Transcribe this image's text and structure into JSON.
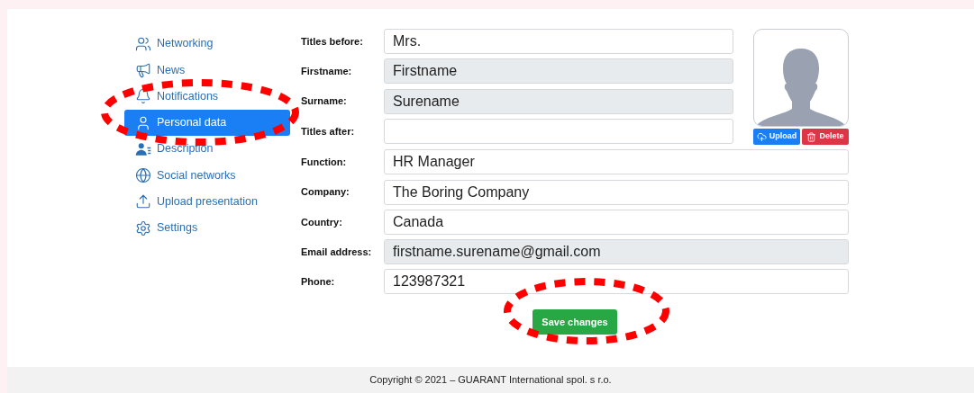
{
  "sidebar": {
    "items": [
      {
        "label": "Networking",
        "selected": false
      },
      {
        "label": "News",
        "selected": false
      },
      {
        "label": "Notifications",
        "selected": false
      },
      {
        "label": "Personal data",
        "selected": true
      },
      {
        "label": "Description",
        "selected": false
      },
      {
        "label": "Social networks",
        "selected": false
      },
      {
        "label": "Upload presentation",
        "selected": false
      },
      {
        "label": "Settings",
        "selected": false
      }
    ]
  },
  "form": {
    "fields": [
      {
        "label": "Titles before:",
        "value": "Mrs.",
        "disabled": false
      },
      {
        "label": "Firstname:",
        "value": "Firstname",
        "disabled": true
      },
      {
        "label": "Surname:",
        "value": "Surename",
        "disabled": true
      },
      {
        "label": "Titles after:",
        "disabled": false
      },
      {
        "label": "Function:",
        "value": "HR Manager",
        "disabled": false
      },
      {
        "label": "Company:",
        "value": "The Boring Company",
        "disabled": false
      },
      {
        "label": "Country:",
        "value": "Canada",
        "disabled": false
      },
      {
        "label": "Email address:",
        "value": "firstname.surename@gmail.com",
        "disabled": true
      },
      {
        "label": "Phone:",
        "value": "123987321",
        "disabled": false
      }
    ],
    "photo": {
      "upload_button": "Upload",
      "delete_button": "Delete"
    },
    "save_button": "Save changes"
  },
  "footer": {
    "text": "Copyright © 2021 – GUARANT International spol. s r.o."
  }
}
